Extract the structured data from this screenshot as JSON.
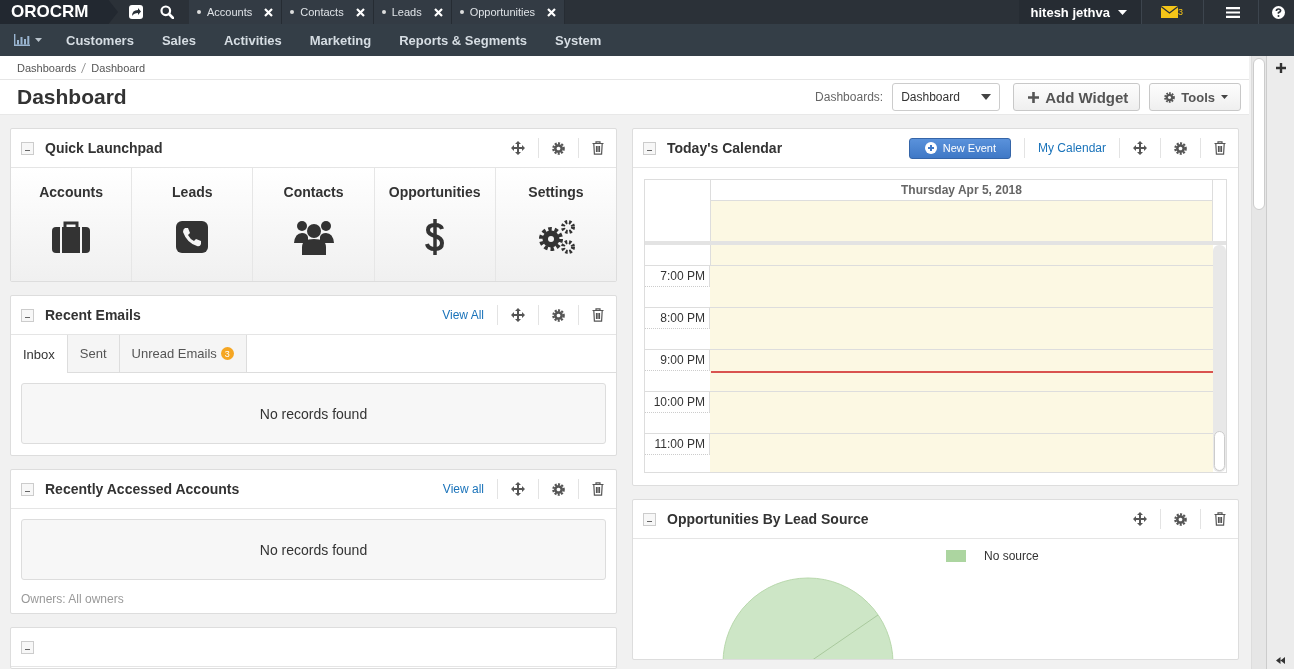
{
  "topbar": {
    "logo": "OROCRM",
    "tabs": [
      {
        "label": "Accounts"
      },
      {
        "label": "Contacts"
      },
      {
        "label": "Leads"
      },
      {
        "label": "Opportunities"
      }
    ],
    "user": "hitesh jethva",
    "mail_count": "3"
  },
  "nav": [
    "Customers",
    "Sales",
    "Activities",
    "Marketing",
    "Reports & Segments",
    "System"
  ],
  "breadcrumb": [
    "Dashboards",
    "Dashboard"
  ],
  "page_title": "Dashboard",
  "dashboard_select": {
    "label": "Dashboards:",
    "value": "Dashboard"
  },
  "buttons": [
    "Add Widget",
    "Tools"
  ],
  "columns": [
    [
      {
        "kind": "launchpad",
        "title": "Quick Launchpad",
        "items": [
          "Accounts",
          "Leads",
          "Contacts",
          "Opportunities",
          "Settings"
        ]
      },
      {
        "kind": "emails",
        "title": "Recent Emails",
        "link": "View All",
        "tabs": [
          {
            "label": "Inbox",
            "selected": true
          },
          {
            "label": "Sent",
            "selected": false
          },
          {
            "label": "Unread Emails",
            "badge": "3",
            "selected": false
          }
        ],
        "empty": "No records found"
      },
      {
        "kind": "list",
        "title": "Recently Accessed Accounts",
        "link": "View all",
        "empty": "No records found",
        "footer": "Owners: All owners"
      },
      {
        "kind": "stub"
      }
    ],
    [
      {
        "kind": "calendar",
        "title": "Today's Calendar",
        "button": "New Event",
        "link": "My Calendar",
        "date": "Thursday Apr 5, 2018",
        "hours": [
          "7:00 PM",
          "8:00 PM",
          "9:00 PM",
          "10:00 PM",
          "11:00 PM"
        ]
      },
      {
        "kind": "pie",
        "title": "Opportunities By Lead Source",
        "legend": [
          {
            "label": "No source",
            "color": "#acd5a0"
          }
        ]
      }
    ]
  ]
}
